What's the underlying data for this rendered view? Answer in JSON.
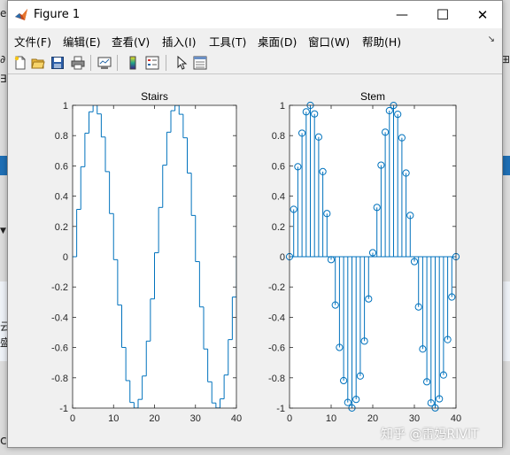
{
  "window": {
    "title": "Figure 1",
    "minimize_glyph": "—",
    "maximize_glyph": "☐",
    "close_glyph": "✕"
  },
  "menu": {
    "items": [
      "文件(F)",
      "编辑(E)",
      "查看(V)",
      "插入(I)",
      "工具(T)",
      "桌面(D)",
      "窗口(W)",
      "帮助(H)"
    ],
    "overflow_glyph": "↘"
  },
  "toolbar": {
    "icons": [
      "new-figure-icon",
      "open-file-icon",
      "save-icon",
      "print-icon",
      "link-plot-icon",
      "insert-colorbar-icon",
      "insert-legend-icon",
      "edit-plot-icon",
      "property-inspector-icon"
    ]
  },
  "watermark": "知乎 @雷妈RIVIT",
  "background_fragments": [
    "e",
    "∂",
    "⊞",
    "∃",
    "▼",
    "云",
    "盛",
    "ce"
  ],
  "colors": {
    "line": "#0072bd",
    "axes_bg": "#ffffff",
    "figure_bg": "#f0f0f0"
  },
  "chart_data": [
    {
      "type": "line",
      "subtype": "stairs",
      "title": "Stairs",
      "xlim": [
        0,
        40
      ],
      "ylim": [
        -1,
        1
      ],
      "xticks": [
        0,
        10,
        20,
        30,
        40
      ],
      "yticks": [
        -1,
        -0.8,
        -0.6,
        -0.4,
        -0.2,
        0,
        0.2,
        0.4,
        0.6,
        0.8,
        1
      ],
      "ytick_labels": [
        "-1",
        "-0.8",
        "-0.6",
        "-0.4",
        "-0.2",
        "0",
        "0.2",
        "0.4",
        "0.6",
        "0.8",
        "1"
      ],
      "xtick_labels": [
        "0",
        "10",
        "20",
        "30",
        "40"
      ],
      "grid": false,
      "x": [
        0,
        1,
        2,
        3,
        4,
        5,
        6,
        7,
        8,
        9,
        10,
        11,
        12,
        13,
        14,
        15,
        16,
        17,
        18,
        19,
        20,
        21,
        22,
        23,
        24,
        25,
        26,
        27,
        28,
        29,
        30,
        31,
        32,
        33,
        34,
        35,
        36,
        37,
        38,
        39,
        40
      ],
      "y": [
        0,
        0.3129,
        0.5944,
        0.8163,
        0.9573,
        1.0,
        0.9433,
        0.7908,
        0.5621,
        0.2849,
        -0.0195,
        -0.3193,
        -0.5992,
        -0.8185,
        -0.9628,
        -0.9994,
        -0.9426,
        -0.7881,
        -0.5574,
        -0.2789,
        0.0261,
        0.3256,
        0.6049,
        0.8226,
        0.9647,
        0.9993,
        0.9409,
        0.7856,
        0.5525,
        0.2726,
        -0.0324,
        -0.3318,
        -0.6097,
        -0.8264,
        -0.9663,
        -0.9989,
        -0.9391,
        -0.7815,
        -0.5475,
        -0.2663,
        0.0
      ]
    },
    {
      "type": "scatter",
      "subtype": "stem",
      "title": "Stem",
      "xlim": [
        0,
        40
      ],
      "ylim": [
        -1,
        1
      ],
      "xticks": [
        0,
        10,
        20,
        30,
        40
      ],
      "yticks": [
        -1,
        -0.8,
        -0.6,
        -0.4,
        -0.2,
        0,
        0.2,
        0.4,
        0.6,
        0.8,
        1
      ],
      "ytick_labels": [
        "-1",
        "-0.8",
        "-0.6",
        "-0.4",
        "-0.2",
        "0",
        "0.2",
        "0.4",
        "0.6",
        "0.8",
        "1"
      ],
      "xtick_labels": [
        "0",
        "10",
        "20",
        "30",
        "40"
      ],
      "grid": false,
      "x": [
        0,
        1,
        2,
        3,
        4,
        5,
        6,
        7,
        8,
        9,
        10,
        11,
        12,
        13,
        14,
        15,
        16,
        17,
        18,
        19,
        20,
        21,
        22,
        23,
        24,
        25,
        26,
        27,
        28,
        29,
        30,
        31,
        32,
        33,
        34,
        35,
        36,
        37,
        38,
        39,
        40
      ],
      "y": [
        0,
        0.3129,
        0.5944,
        0.8163,
        0.9573,
        1.0,
        0.9433,
        0.7908,
        0.5621,
        0.2849,
        -0.0195,
        -0.3193,
        -0.5992,
        -0.8185,
        -0.9628,
        -0.9994,
        -0.9426,
        -0.7881,
        -0.5574,
        -0.2789,
        0.0261,
        0.3256,
        0.6049,
        0.8226,
        0.9647,
        0.9993,
        0.9409,
        0.7856,
        0.5525,
        0.2726,
        -0.0324,
        -0.3318,
        -0.6097,
        -0.8264,
        -0.9663,
        -0.9989,
        -0.9391,
        -0.7815,
        -0.5475,
        -0.2663,
        0.0
      ]
    }
  ]
}
